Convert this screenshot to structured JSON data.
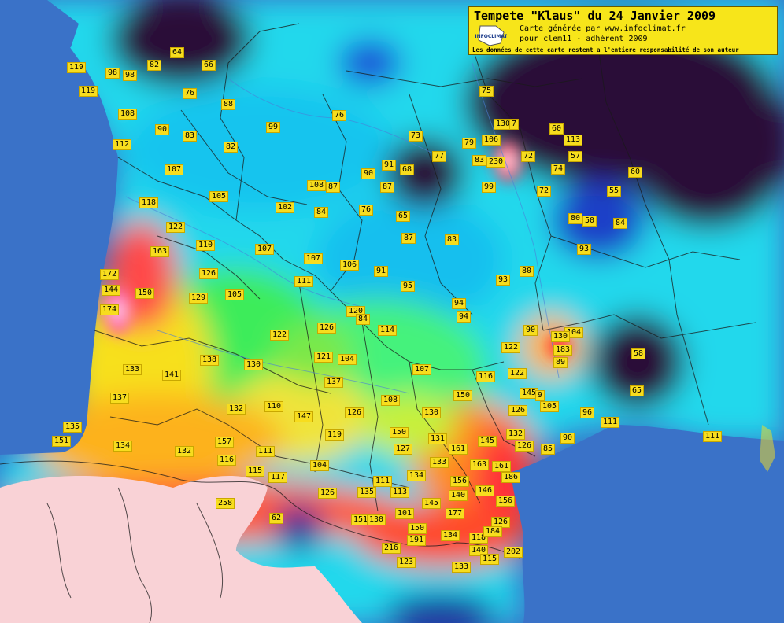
{
  "header": {
    "title": "Tempete \"Klaus\" du 24 Janvier 2009",
    "line1": "Carte générée par www.infoclimat.fr",
    "line2": "pour clem11 - adhérent 2009",
    "line3": "Les données de cette carte restent a l'entiere responsabilité de son auteur",
    "logo_text": "INFOCLIMAT"
  },
  "colors": {
    "sea": "#3a72c8",
    "label_bg": "#f7dd1e",
    "low": "#2a0838",
    "high": "#ff1e3c"
  },
  "stations": [
    {
      "v": "64"
    },
    {
      "v": "66"
    },
    {
      "v": "119"
    },
    {
      "v": "82"
    },
    {
      "v": "98"
    },
    {
      "v": "98"
    },
    {
      "v": "119"
    },
    {
      "v": "76"
    },
    {
      "v": "88"
    },
    {
      "v": "108"
    },
    {
      "v": "90"
    },
    {
      "v": "83"
    },
    {
      "v": "82"
    },
    {
      "v": "99"
    },
    {
      "v": "76"
    },
    {
      "v": "112"
    },
    {
      "v": "107"
    },
    {
      "v": "105"
    },
    {
      "v": "118"
    },
    {
      "v": "102"
    },
    {
      "v": "84"
    },
    {
      "v": "108"
    },
    {
      "v": "87"
    },
    {
      "v": "90"
    },
    {
      "v": "91"
    },
    {
      "v": "68"
    },
    {
      "v": "87"
    },
    {
      "v": "76"
    },
    {
      "v": "65"
    },
    {
      "v": "73"
    },
    {
      "v": "77"
    },
    {
      "v": "79"
    },
    {
      "v": "106"
    },
    {
      "v": "130"
    },
    {
      "v": "7"
    },
    {
      "v": "83"
    },
    {
      "v": "230"
    },
    {
      "v": "72"
    },
    {
      "v": "74"
    },
    {
      "v": "72"
    },
    {
      "v": "99"
    },
    {
      "v": "75"
    },
    {
      "v": "60"
    },
    {
      "v": "113"
    },
    {
      "v": "57"
    },
    {
      "v": "60"
    },
    {
      "v": "55"
    },
    {
      "v": "80"
    },
    {
      "v": "50"
    },
    {
      "v": "84"
    },
    {
      "v": "93"
    },
    {
      "v": "122"
    },
    {
      "v": "163"
    },
    {
      "v": "110"
    },
    {
      "v": "107"
    },
    {
      "v": "107"
    },
    {
      "v": "106"
    },
    {
      "v": "126"
    },
    {
      "v": "111"
    },
    {
      "v": "91"
    },
    {
      "v": "87"
    },
    {
      "v": "83"
    },
    {
      "v": "93"
    },
    {
      "v": "80"
    },
    {
      "v": "172"
    },
    {
      "v": "144"
    },
    {
      "v": "150"
    },
    {
      "v": "129"
    },
    {
      "v": "105"
    },
    {
      "v": "174"
    },
    {
      "v": "95"
    },
    {
      "v": "94"
    },
    {
      "v": "94"
    },
    {
      "v": "120"
    },
    {
      "v": "84"
    },
    {
      "v": "126"
    },
    {
      "v": "114"
    },
    {
      "v": "122"
    },
    {
      "v": "90"
    },
    {
      "v": "104"
    },
    {
      "v": "130"
    },
    {
      "v": "183"
    },
    {
      "v": "89"
    },
    {
      "v": "122"
    },
    {
      "v": "58"
    },
    {
      "v": "138"
    },
    {
      "v": "121"
    },
    {
      "v": "104"
    },
    {
      "v": "130"
    },
    {
      "v": "133"
    },
    {
      "v": "141"
    },
    {
      "v": "107"
    },
    {
      "v": "116"
    },
    {
      "v": "122"
    },
    {
      "v": "137"
    },
    {
      "v": "145"
    },
    {
      "v": "9"
    },
    {
      "v": "65"
    },
    {
      "v": "137"
    },
    {
      "v": "132"
    },
    {
      "v": "110"
    },
    {
      "v": "126"
    },
    {
      "v": "108"
    },
    {
      "v": "130"
    },
    {
      "v": "150"
    },
    {
      "v": "126"
    },
    {
      "v": "105"
    },
    {
      "v": "96"
    },
    {
      "v": "147"
    },
    {
      "v": "135"
    },
    {
      "v": "111"
    },
    {
      "v": "151"
    },
    {
      "v": "134"
    },
    {
      "v": "132"
    },
    {
      "v": "157"
    },
    {
      "v": "119"
    },
    {
      "v": "150"
    },
    {
      "v": "131"
    },
    {
      "v": "145"
    },
    {
      "v": "132"
    },
    {
      "v": "90"
    },
    {
      "v": "111"
    },
    {
      "v": "116"
    },
    {
      "v": "111"
    },
    {
      "v": "127"
    },
    {
      "v": "161"
    },
    {
      "v": "126"
    },
    {
      "v": "85"
    },
    {
      "v": "115"
    },
    {
      "v": "104"
    },
    {
      "v": "133"
    },
    {
      "v": "163"
    },
    {
      "v": "161"
    },
    {
      "v": "117"
    },
    {
      "v": "134"
    },
    {
      "v": "111"
    },
    {
      "v": "156"
    },
    {
      "v": "186"
    },
    {
      "v": "126"
    },
    {
      "v": "135"
    },
    {
      "v": "113"
    },
    {
      "v": "140"
    },
    {
      "v": "146"
    },
    {
      "v": "258"
    },
    {
      "v": "145"
    },
    {
      "v": "156"
    },
    {
      "v": "101"
    },
    {
      "v": "177"
    },
    {
      "v": "62"
    },
    {
      "v": "151"
    },
    {
      "v": "130"
    },
    {
      "v": "150"
    },
    {
      "v": "126"
    },
    {
      "v": "134"
    },
    {
      "v": "118"
    },
    {
      "v": "184"
    },
    {
      "v": "191"
    },
    {
      "v": "216"
    },
    {
      "v": "140"
    },
    {
      "v": "202"
    },
    {
      "v": "115"
    },
    {
      "v": "123"
    },
    {
      "v": "133"
    }
  ]
}
